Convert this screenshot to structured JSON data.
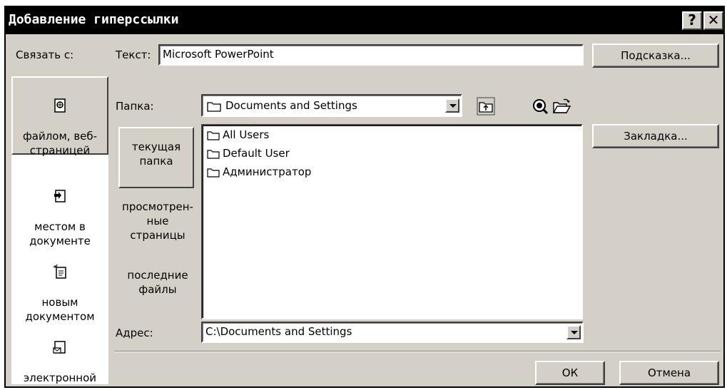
{
  "window": {
    "title": "Добавление гиперссылки",
    "help_label": "?",
    "close_label": "✕"
  },
  "link_to": {
    "label": "Связать с:",
    "items": [
      {
        "label": "файлом, веб-\nстраницей",
        "icon": "web-page-icon",
        "selected": true
      },
      {
        "label": "местом в\nдокументе",
        "icon": "document-place-icon",
        "selected": false
      },
      {
        "label": "новым\nдокументом",
        "icon": "new-document-icon",
        "selected": false
      },
      {
        "label": "электронной\nпочтой",
        "icon": "email-icon",
        "selected": false
      }
    ]
  },
  "text_field": {
    "label": "Текст:",
    "value": "Microsoft PowerPoint"
  },
  "buttons": {
    "hint": "Подсказка...",
    "bookmark": "Закладка...",
    "ok": "ОК",
    "cancel": "Отмена"
  },
  "folder": {
    "label": "Папка:",
    "value": "Documents and Settings"
  },
  "toolbar_icons": [
    "up-folder-icon",
    "search-web-icon",
    "browse-file-icon"
  ],
  "places": [
    {
      "label": "текущая\nпапка",
      "selected": true
    },
    {
      "label": "просмотрен-\nные\nстраницы",
      "selected": false
    },
    {
      "label": "последние\nфайлы",
      "selected": false
    }
  ],
  "files": [
    {
      "name": "All Users",
      "icon": "folder-icon"
    },
    {
      "name": "Default User",
      "icon": "folder-icon"
    },
    {
      "name": "Администратор",
      "icon": "folder-icon"
    }
  ],
  "address": {
    "label": "Адрес:",
    "value": "C:\\Documents and Settings"
  }
}
